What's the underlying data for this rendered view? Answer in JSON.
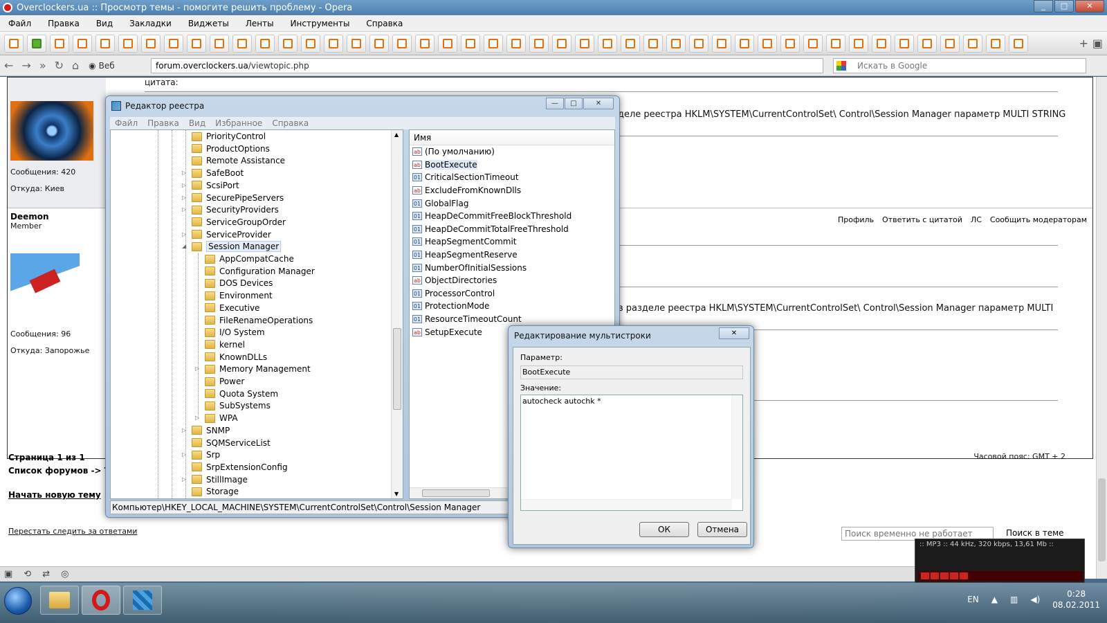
{
  "opera": {
    "title": "Overclockers.ua :: Просмотр темы - помогите решить проблему - Opera",
    "menu": [
      "Файл",
      "Правка",
      "Вид",
      "Закладки",
      "Виджеты",
      "Ленты",
      "Инструменты",
      "Справка"
    ],
    "web_label": "Веб",
    "url_host": "forum.overclockers.ua",
    "url_path": "/viewtopic.php",
    "search_placeholder": "Искать в Google"
  },
  "forum": {
    "quote_label": "цитата:",
    "post1_text": "деле реестра HKLM\\SYSTEM\\CurrentControlSet\\ Control\\Session Manager параметр MULTI STRING",
    "user1_posts": "Сообщения: 420",
    "user1_from": "Откуда: Киев",
    "user2_name": "Deemon",
    "user2_rank": "Member",
    "user2_posts": "Сообщения: 96",
    "user2_from": "Откуда: Запорожье",
    "post2_text": "в разделе реестра HKLM\\SYSTEM\\CurrentControlSet\\ Control\\Session Manager параметр MULTI",
    "links": [
      "Профиль",
      "Ответить с цитатой",
      "ЛС",
      "Сообщить модераторам"
    ],
    "page_info": "Страница 1 из 1",
    "forum_list": "Список форумов -> Т",
    "new_topic": "Начать новую тему",
    "stop_watch": "Перестать следить за ответами",
    "timezone": "Часовой пояс: GMT + 2",
    "search_box": "Поиск временно не работает",
    "search_btn": "Поиск в теме"
  },
  "regedit": {
    "title": "Редактор реестра",
    "menu": [
      "Файл",
      "Правка",
      "Вид",
      "Избранное",
      "Справка"
    ],
    "tree": [
      "PriorityControl",
      "ProductOptions",
      "Remote Assistance",
      "SafeBoot",
      "ScsiPort",
      "SecurePipeServers",
      "SecurityProviders",
      "ServiceGroupOrder",
      "ServiceProvider",
      "Session Manager",
      "AppCompatCache",
      "Configuration Manager",
      "DOS Devices",
      "Environment",
      "Executive",
      "FileRenameOperations",
      "I/O System",
      "kernel",
      "KnownDLLs",
      "Memory Management",
      "Power",
      "Quota System",
      "SubSystems",
      "WPA",
      "SNMP",
      "SQMServiceList",
      "Srp",
      "SrpExtensionConfig",
      "StillImage",
      "Storage"
    ],
    "values_header": "Имя",
    "values": [
      "(По умолчанию)",
      "BootExecute",
      "CriticalSectionTimeout",
      "ExcludeFromKnownDlls",
      "GlobalFlag",
      "HeapDeCommitFreeBlockThreshold",
      "HeapDeCommitTotalFreeThreshold",
      "HeapSegmentCommit",
      "HeapSegmentReserve",
      "NumberOfInitialSessions",
      "ObjectDirectories",
      "ProcessorControl",
      "ProtectionMode",
      "ResourceTimeoutCount",
      "SetupExecute"
    ],
    "status": "Компьютер\\HKEY_LOCAL_MACHINE\\SYSTEM\\CurrentControlSet\\Control\\Session Manager"
  },
  "dialog": {
    "title": "Редактирование мультистроки",
    "param_label": "Параметр:",
    "param_value": "BootExecute",
    "value_label": "Значение:",
    "value_text": "autocheck autochk *",
    "ok": "ОК",
    "cancel": "Отмена"
  },
  "player": {
    "info": ":: MP3 :: 44 kHz, 320 kbps, 13,61 Mb ::"
  },
  "taskbar": {
    "lang": "EN",
    "time": "0:28",
    "date": "08.02.2011"
  }
}
